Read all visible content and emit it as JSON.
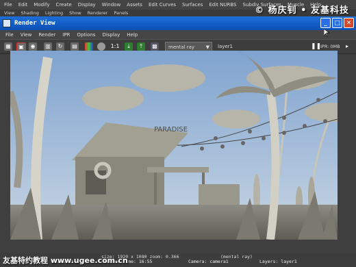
{
  "maya_menu": [
    "File",
    "Edit",
    "Modify",
    "Create",
    "Display",
    "Window",
    "Assets",
    "Edit Curves",
    "Surfaces",
    "Edit NURBS",
    "Subdiv Surfaces",
    "Muscle",
    "Help"
  ],
  "maya_submenu": [
    "View",
    "Shading",
    "Lighting",
    "Show",
    "Renderer",
    "Panels"
  ],
  "watermark_top": "© 杨庆钊 • 友基科技",
  "window": {
    "title": "Render View",
    "menu": [
      "File",
      "View",
      "Render",
      "IPR",
      "Options",
      "Display",
      "Help"
    ]
  },
  "toolbar": {
    "ratio_label": "1:1",
    "renderer": "mental ray",
    "layer": "layer1",
    "ipr_status": "IPR: 0MB"
  },
  "status": {
    "size_line": "size: 1920 x 1080  zoom: 0.366",
    "renderer_tag": "(mental ray)",
    "frame": "Frame:  1",
    "render_time": "Render Time: 16:55",
    "camera": "Camera: camera1",
    "layers": "Layers: layer1"
  },
  "footer_watermark": "友基特约教程 www.ugee.com.cn",
  "colors": {
    "titlebar": "#1e6fd9",
    "close_button": "#d9472b",
    "sky": "#9fb9d5"
  }
}
